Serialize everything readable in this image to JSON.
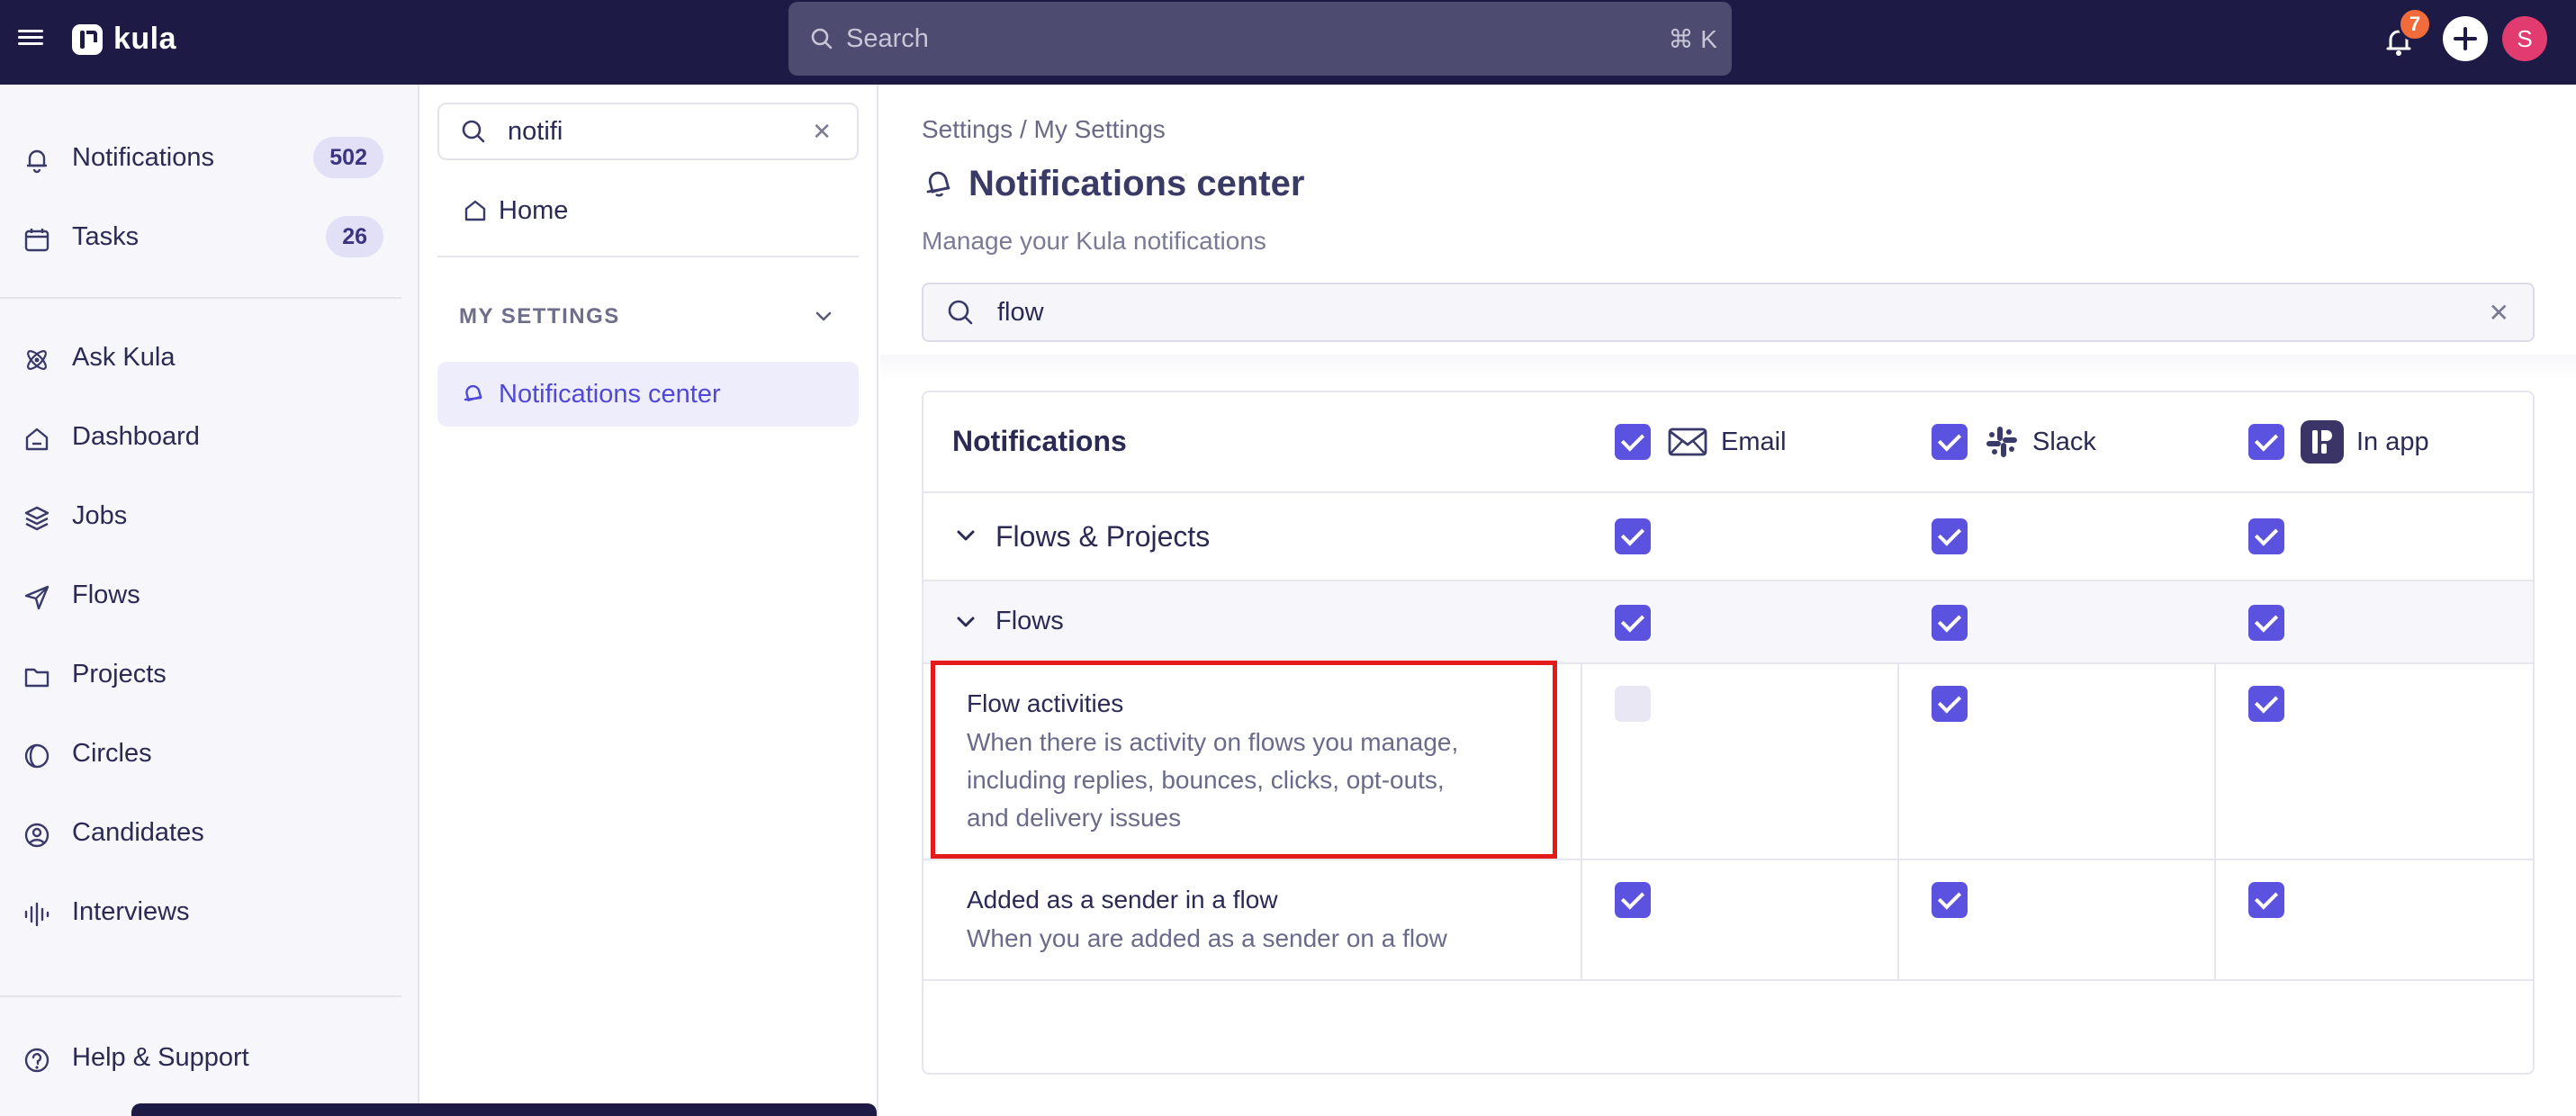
{
  "topbar": {
    "logo_text": "kula",
    "search_placeholder": "Search",
    "search_shortcut": "⌘ K",
    "notification_count": "7",
    "avatar_initial": "S"
  },
  "sidebar": {
    "items": [
      {
        "label": "Notifications",
        "count": "502",
        "icon": "bell-icon"
      },
      {
        "label": "Tasks",
        "count": "26",
        "icon": "calendar-icon"
      },
      {
        "label": "Ask Kula",
        "icon": "atom-icon"
      },
      {
        "label": "Dashboard",
        "icon": "home-icon"
      },
      {
        "label": "Jobs",
        "icon": "layers-icon"
      },
      {
        "label": "Flows",
        "icon": "send-icon"
      },
      {
        "label": "Projects",
        "icon": "folder-icon"
      },
      {
        "label": "Circles",
        "icon": "circles-icon"
      },
      {
        "label": "Candidates",
        "icon": "user-circle-icon"
      },
      {
        "label": "Interviews",
        "icon": "audio-wave-icon"
      }
    ],
    "help_label": "Help & Support"
  },
  "settings_nav": {
    "search_value": "notifi",
    "home_label": "Home",
    "section_label": "MY SETTINGS",
    "active_item": "Notifications center"
  },
  "main": {
    "breadcrumb": "Settings / My Settings",
    "title": "Notifications center",
    "subtitle": "Manage your Kula notifications",
    "search_value": "flow"
  },
  "table": {
    "header": "Notifications",
    "channels": [
      {
        "label": "Email",
        "checked": true
      },
      {
        "label": "Slack",
        "checked": true
      },
      {
        "label": "In app",
        "checked": true
      }
    ],
    "group": {
      "label": "Flows & Projects",
      "email": true,
      "slack": true,
      "inapp": true
    },
    "subgroup": {
      "label": "Flows",
      "email": true,
      "slack": true,
      "inapp": true
    },
    "items": [
      {
        "title": "Flow activities",
        "desc_lines": [
          "When there is activity on flows you manage,",
          "including replies, bounces, clicks, opt-outs,",
          "and delivery issues"
        ],
        "email": false,
        "slack": true,
        "inapp": true
      },
      {
        "title": "Added as a sender in a flow",
        "desc_lines": [
          "When you are added as a sender on a flow"
        ],
        "email": true,
        "slack": true,
        "inapp": true
      }
    ]
  },
  "colors": {
    "topbar_bg": "#1d1b45",
    "accent": "#5b52e0",
    "highlight": "#e41b1b"
  }
}
